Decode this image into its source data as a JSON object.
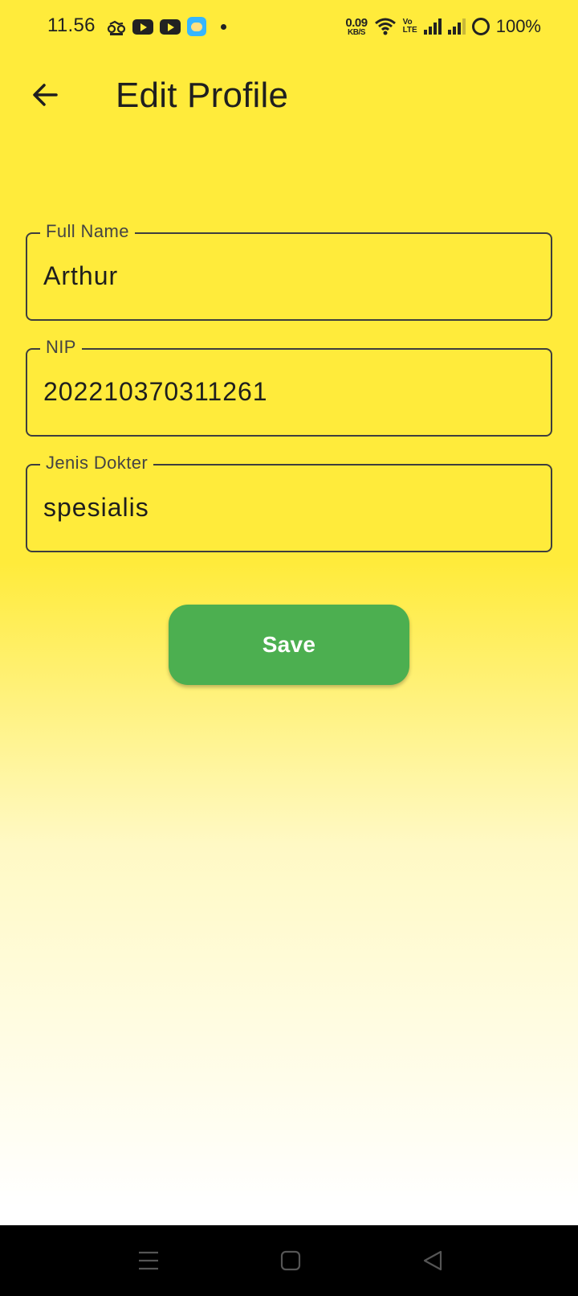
{
  "status_bar": {
    "time": "11.56",
    "net_speed_value": "0.09",
    "net_speed_unit": "KB/S",
    "volte_top": "Vo",
    "volte_bottom": "LTE",
    "battery_percent": "100%",
    "icons": [
      "motorbike-app-icon",
      "youtube-icon",
      "youtube-icon",
      "kids-app-icon",
      "notification-dot-icon",
      "wifi-icon",
      "volte-icon",
      "signal-icon",
      "signal-icon",
      "battery-icon"
    ]
  },
  "app_bar": {
    "back_icon": "arrow-back-icon",
    "title": "Edit Profile"
  },
  "form": {
    "full_name": {
      "label": "Full Name",
      "value": "Arthur"
    },
    "nip": {
      "label": "NIP",
      "value": "202210370311261"
    },
    "jenis_dokter": {
      "label": "Jenis Dokter",
      "value": "spesialis"
    },
    "save_label": "Save"
  },
  "nav_bar": {
    "icons": [
      "menu-icon",
      "home-icon",
      "back-triangle-icon"
    ]
  },
  "colors": {
    "background_top": "#ffeb3b",
    "background_bottom": "#ffffff",
    "save_button": "#4caf50",
    "nav_bar": "#000000"
  }
}
